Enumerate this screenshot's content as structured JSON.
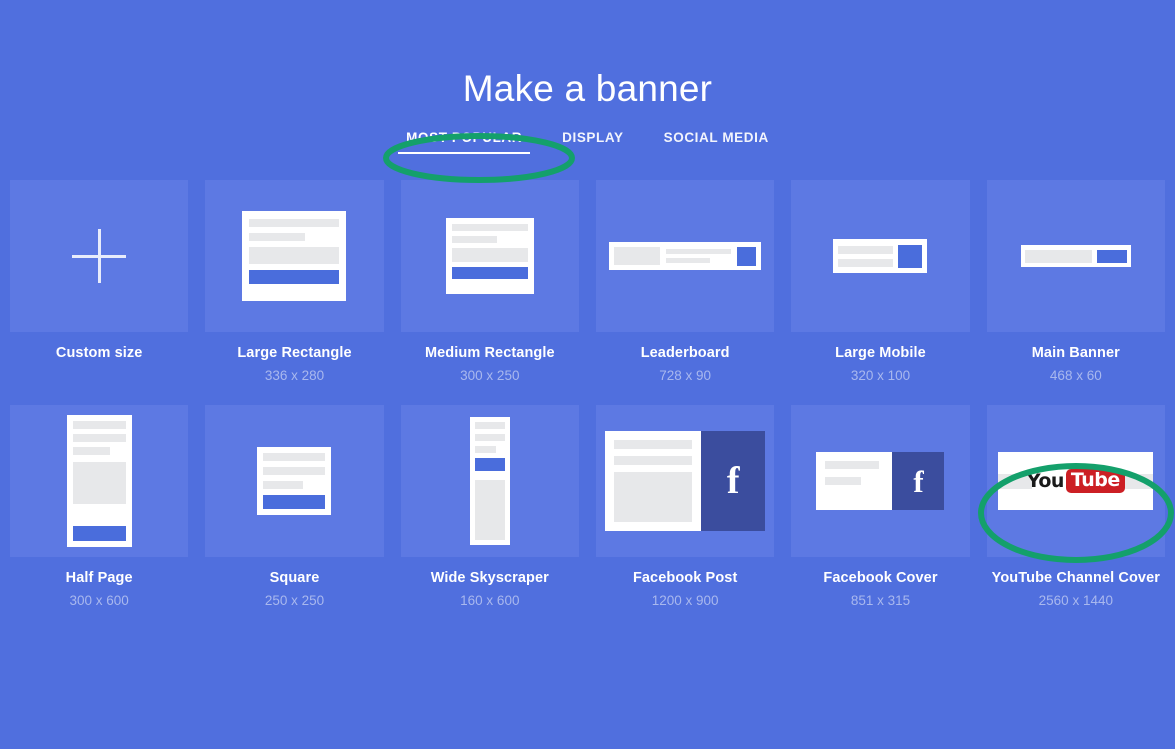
{
  "header": {
    "title": "Make a banner",
    "tabs": [
      {
        "label": "MOST POPULAR",
        "active": true
      },
      {
        "label": "DISPLAY",
        "active": false
      },
      {
        "label": "SOCIAL MEDIA",
        "active": false
      }
    ]
  },
  "colors": {
    "background": "#506fde",
    "card": "#5d79e3",
    "accent_blue": "#4a6ddc",
    "facebook_blue": "#3b4d9e",
    "youtube_red": "#cc1f24",
    "annotation_green": "#14a06b",
    "label_text": "#ffffff",
    "dims_text": "#a9b8ee"
  },
  "cards": [
    {
      "id": "custom-size",
      "label": "Custom size",
      "dims": "",
      "icon": "plus-icon"
    },
    {
      "id": "large-rectangle",
      "label": "Large Rectangle",
      "dims": "336 x 280",
      "icon": "large-rectangle-mock"
    },
    {
      "id": "medium-rectangle",
      "label": "Medium Rectangle",
      "dims": "300 x 250",
      "icon": "medium-rectangle-mock"
    },
    {
      "id": "leaderboard",
      "label": "Leaderboard",
      "dims": "728 x 90",
      "icon": "leaderboard-mock"
    },
    {
      "id": "large-mobile",
      "label": "Large Mobile",
      "dims": "320 x 100",
      "icon": "large-mobile-mock"
    },
    {
      "id": "main-banner",
      "label": "Main Banner",
      "dims": "468 x 60",
      "icon": "main-banner-mock"
    },
    {
      "id": "half-page",
      "label": "Half Page",
      "dims": "300 x 600",
      "icon": "half-page-mock"
    },
    {
      "id": "square",
      "label": "Square",
      "dims": "250 x 250",
      "icon": "square-mock"
    },
    {
      "id": "wide-skyscraper",
      "label": "Wide Skyscraper",
      "dims": "160 x 600",
      "icon": "wide-skyscraper-mock"
    },
    {
      "id": "facebook-post",
      "label": "Facebook Post",
      "dims": "1200 x 900",
      "icon": "facebook-post-mock"
    },
    {
      "id": "facebook-cover",
      "label": "Facebook Cover",
      "dims": "851 x 315",
      "icon": "facebook-cover-mock"
    },
    {
      "id": "youtube-channel-cover",
      "label": "YouTube Channel Cover",
      "dims": "2560 x 1440",
      "icon": "youtube-cover-mock"
    }
  ],
  "logos": {
    "facebook_letter": "f",
    "youtube_word_one": "You",
    "youtube_word_two": "Tube"
  },
  "annotations": [
    {
      "id": "highlight-most-popular-tab",
      "shape": "ellipse"
    },
    {
      "id": "highlight-youtube-channel-cover",
      "shape": "ellipse"
    }
  ]
}
